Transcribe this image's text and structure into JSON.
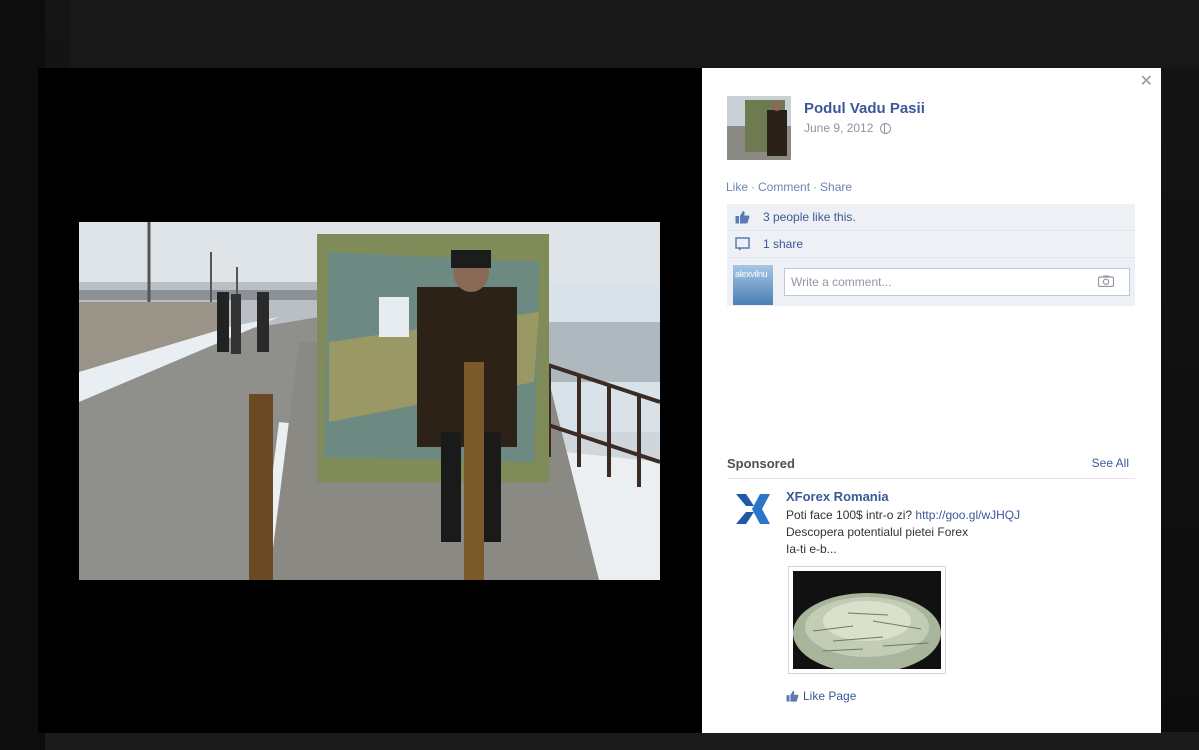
{
  "post": {
    "author": "Podul Vadu Pasii",
    "date": "June 9, 2012",
    "privacy_icon": "globe-icon",
    "actions": {
      "like": "Like",
      "comment": "Comment",
      "share": "Share"
    },
    "likes_text": "3 people like this.",
    "shares_text": "1 share",
    "comment_placeholder": "Write a comment...",
    "commenter_avatar_text": "alexvilnu"
  },
  "sponsored": {
    "label": "Sponsored",
    "see_all": "See All",
    "ad": {
      "title": "XForex Romania",
      "line1": "Poti face 100$ intr-o zi?",
      "link": "http://goo.gl/wJHQJ",
      "line2": "Descopera potentialul pietei Forex",
      "line3": "Ia-ti e-b...",
      "like_page": "Like Page"
    }
  },
  "colors": {
    "link": "#3b5998",
    "muted": "#90949c",
    "ufi_bg": "#edf0f5"
  },
  "icons": {
    "close": "close-icon",
    "camera": "camera-icon",
    "like": "thumbs-up-icon",
    "share": "share-icon"
  }
}
